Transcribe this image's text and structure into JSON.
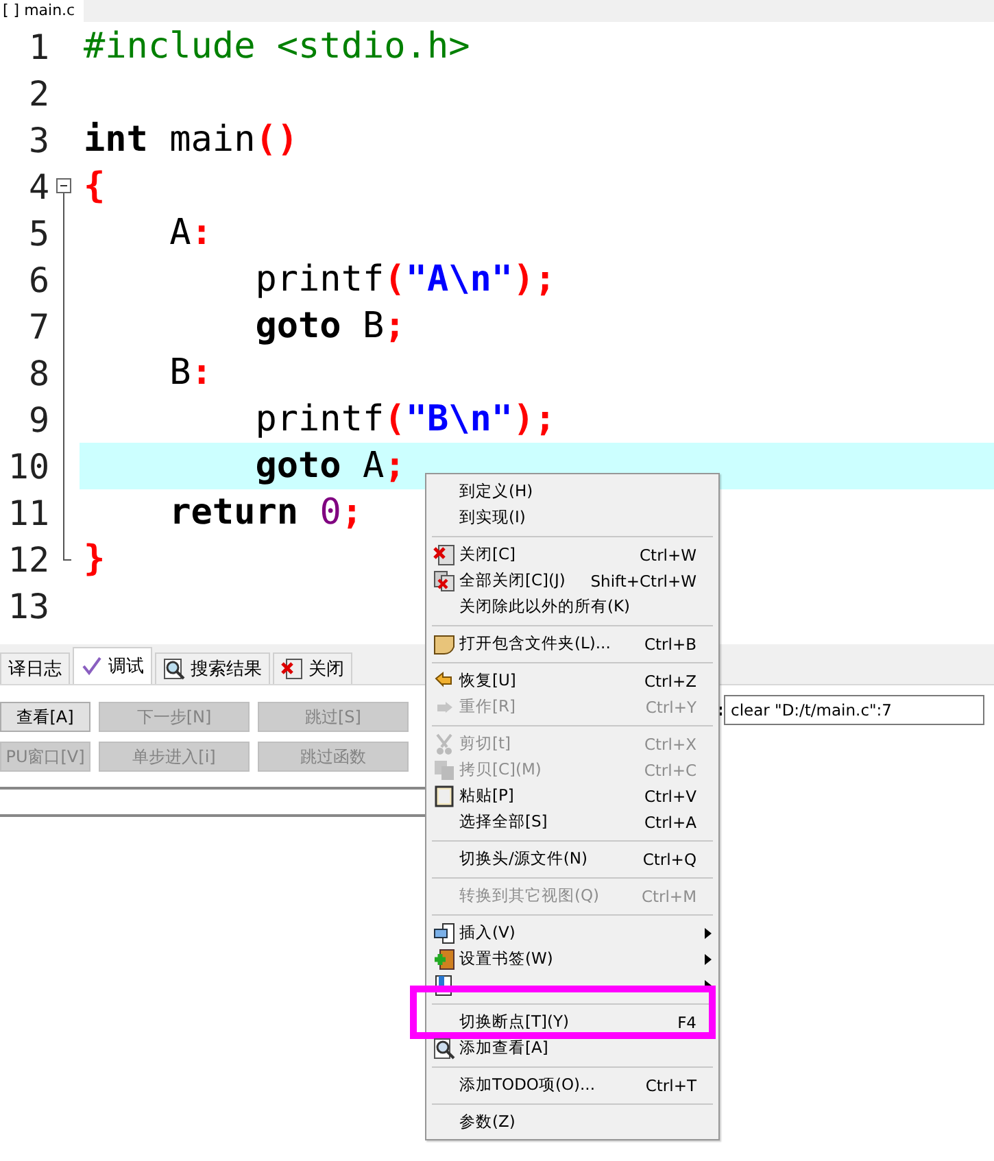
{
  "editor": {
    "file_tab": "[ ] main.c",
    "lines": [
      {
        "number": "1",
        "highlighted": false,
        "tokens": [
          {
            "kind": "preproc",
            "text": "#include <stdio.h>"
          }
        ]
      },
      {
        "number": "2",
        "highlighted": false
      },
      {
        "number": "3",
        "highlighted": false,
        "tokens": [
          {
            "kind": "keyword",
            "text": "int"
          },
          {
            "kind": "plain",
            "text": " main"
          },
          {
            "kind": "punct",
            "text": "()"
          }
        ]
      },
      {
        "number": "4",
        "highlighted": false,
        "expanded": true,
        "tokens": [
          {
            "kind": "punct",
            "text": "{"
          }
        ],
        "children": [
          {
            "number": "5",
            "highlighted": false,
            "tokens": [
              {
                "kind": "plain",
                "text": "    A"
              },
              {
                "kind": "punct",
                "text": ":"
              }
            ]
          },
          {
            "number": "6",
            "highlighted": false,
            "tokens": [
              {
                "kind": "plain",
                "text": "        printf"
              },
              {
                "kind": "punct",
                "text": "("
              },
              {
                "kind": "string",
                "text": "\"A\\n\""
              },
              {
                "kind": "punct",
                "text": ");"
              }
            ]
          },
          {
            "number": "7",
            "highlighted": false,
            "tokens": [
              {
                "kind": "keyword",
                "text": "        goto"
              },
              {
                "kind": "plain",
                "text": " B"
              },
              {
                "kind": "punct",
                "text": ";"
              }
            ]
          },
          {
            "number": "8",
            "highlighted": false,
            "tokens": [
              {
                "kind": "plain",
                "text": "    B"
              },
              {
                "kind": "punct",
                "text": ":"
              }
            ]
          },
          {
            "number": "9",
            "highlighted": false,
            "tokens": [
              {
                "kind": "plain",
                "text": "        printf"
              },
              {
                "kind": "punct",
                "text": "("
              },
              {
                "kind": "string",
                "text": "\"B\\n\""
              },
              {
                "kind": "punct",
                "text": ");"
              }
            ]
          },
          {
            "number": "10",
            "highlighted": true,
            "tokens": [
              {
                "kind": "keyword",
                "text": "        goto"
              },
              {
                "kind": "plain",
                "text": " A"
              },
              {
                "kind": "punct",
                "text": ";"
              }
            ]
          },
          {
            "number": "11",
            "highlighted": false,
            "tokens": [
              {
                "kind": "keyword",
                "text": "    return "
              },
              {
                "kind": "number",
                "text": "0"
              },
              {
                "kind": "punct",
                "text": ";"
              }
            ]
          }
        ]
      },
      {
        "number": "12",
        "highlighted": false,
        "tokens": [
          {
            "kind": "punct",
            "text": "}"
          }
        ]
      },
      {
        "number": "13",
        "highlighted": false
      }
    ]
  },
  "panel": {
    "tabs": [
      {
        "label": "译日志",
        "selected": false
      },
      {
        "label": "调试",
        "selected": true
      },
      {
        "label": "搜索结果",
        "selected": false
      },
      {
        "label": "关闭",
        "selected": false
      }
    ],
    "buttons": [
      {
        "label": "查看[A]",
        "disabled": false
      },
      {
        "label": "下一步[N]",
        "disabled": true
      },
      {
        "label": "跳过[S]",
        "disabled": true
      },
      {
        "label": "PU窗口[V]",
        "disabled": true
      },
      {
        "label": "单步进入[i]",
        "disabled": true
      },
      {
        "label": "跳过函数",
        "disabled": true
      }
    ],
    "command_label": ":",
    "command_value": "clear \"D:/t/main.c\":7"
  },
  "context_menu": {
    "items": [
      {
        "kind": "item",
        "label": "到定义(H)",
        "disabled": false,
        "marked": false
      },
      {
        "kind": "item",
        "label": "到实现(I)",
        "disabled": false,
        "marked": false
      },
      {
        "kind": "separator"
      },
      {
        "kind": "item",
        "label": "关闭[C]",
        "shortcut": "Ctrl+W",
        "disabled": false,
        "marked": false
      },
      {
        "kind": "item",
        "label": "全部关闭[C](J)",
        "shortcut": "Shift+Ctrl+W",
        "disabled": false,
        "marked": false
      },
      {
        "kind": "item",
        "label": "关闭除此以外的所有(K)",
        "disabled": false,
        "marked": false
      },
      {
        "kind": "separator"
      },
      {
        "kind": "item",
        "label": "打开包含文件夹(L)...",
        "shortcut": "Ctrl+B",
        "disabled": false,
        "marked": false
      },
      {
        "kind": "separator"
      },
      {
        "kind": "item",
        "label": "恢复[U]",
        "shortcut": "Ctrl+Z",
        "disabled": false,
        "marked": false
      },
      {
        "kind": "item",
        "label": "重作[R]",
        "shortcut": "Ctrl+Y",
        "disabled": true,
        "marked": false
      },
      {
        "kind": "separator"
      },
      {
        "kind": "item",
        "label": "剪切[t]",
        "shortcut": "Ctrl+X",
        "disabled": true,
        "marked": false
      },
      {
        "kind": "item",
        "label": "拷贝[C](M)",
        "shortcut": "Ctrl+C",
        "disabled": true,
        "marked": false
      },
      {
        "kind": "item",
        "label": "粘贴[P]",
        "shortcut": "Ctrl+V",
        "disabled": false,
        "marked": false
      },
      {
        "kind": "item",
        "label": "选择全部[S]",
        "shortcut": "Ctrl+A",
        "disabled": false,
        "marked": false
      },
      {
        "kind": "separator"
      },
      {
        "kind": "item",
        "label": "切换头/源文件(N)",
        "shortcut": "Ctrl+Q",
        "disabled": false,
        "marked": false
      },
      {
        "kind": "separator"
      },
      {
        "kind": "item",
        "label": "转换到其它视图(Q)",
        "shortcut": "Ctrl+M",
        "disabled": true,
        "marked": false
      },
      {
        "kind": "separator"
      },
      {
        "kind": "submenu",
        "label": "插入(V)",
        "disabled": false,
        "marked": false
      },
      {
        "kind": "submenu",
        "label": "设置书签(W)",
        "disabled": false,
        "marked": false
      },
      {
        "kind": "submenu"
      },
      {
        "kind": "separator"
      },
      {
        "kind": "item",
        "label": "切换断点[T](Y)",
        "shortcut": "F4",
        "disabled": false,
        "marked": true
      },
      {
        "kind": "item",
        "label": "添加查看[A]",
        "disabled": false,
        "marked": false
      },
      {
        "kind": "separator"
      },
      {
        "kind": "item",
        "label": "添加TODO项(O)...",
        "shortcut": "Ctrl+T",
        "disabled": false,
        "marked": false
      },
      {
        "kind": "separator"
      },
      {
        "kind": "item",
        "label": "参数(Z)",
        "disabled": false,
        "marked": false
      }
    ]
  }
}
